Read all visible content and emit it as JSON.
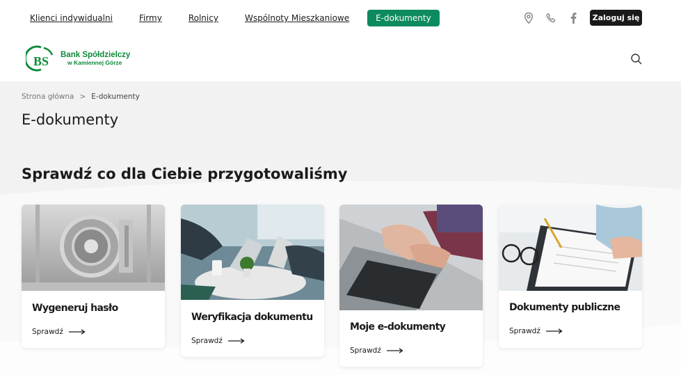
{
  "nav": {
    "items": [
      {
        "label": "Klienci indywidualni"
      },
      {
        "label": "Firmy"
      },
      {
        "label": "Rolnicy"
      },
      {
        "label": "Wspólnoty Mieszkaniowe"
      },
      {
        "label": "E-dokumenty"
      }
    ],
    "login_label": "Zaloguj się",
    "icons": [
      "location-pin-icon",
      "phone-icon",
      "facebook-icon"
    ]
  },
  "logo": {
    "mark": "BS",
    "line1": "Bank Spółdzielczy",
    "line2": "w Kamiennej Górze"
  },
  "breadcrumb": {
    "home": "Strona główna",
    "separator": ">",
    "current": "E-dokumenty"
  },
  "page_title": "E-dokumenty",
  "section": {
    "part1": "Sprawdź co dla ",
    "bold": "Ciebie",
    "part2": " przygotowaliśmy"
  },
  "cards": [
    {
      "title": "Wygeneruj hasło",
      "link": "Sprawdź",
      "image": "vault-door"
    },
    {
      "title": "Weryfikacja dokumentu",
      "link": "Sprawdź",
      "image": "meeting-table-laptops"
    },
    {
      "title": "Moje e-dokumenty",
      "link": "Sprawdź",
      "image": "typing-laptop"
    },
    {
      "title": "Dokumenty publiczne",
      "link": "Sprawdź",
      "image": "signing-document"
    }
  ],
  "colors": {
    "accent": "#0d8a5e",
    "logo_green": "#0d8a3a",
    "dark": "#1a1a1a",
    "page_bg": "#f2f2f2"
  }
}
